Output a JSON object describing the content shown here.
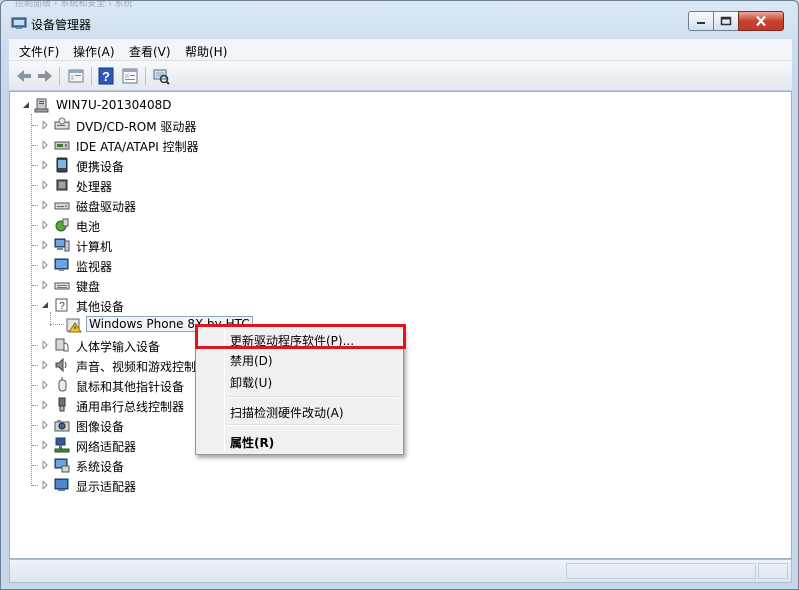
{
  "window": {
    "title": "设备管理器",
    "background_hint": "控制面板 › 系统和安全 › 系统"
  },
  "caption_buttons": {
    "min_icon": "minimize-icon",
    "max_icon": "maximize-icon",
    "close_icon": "close-icon"
  },
  "menu": [
    "文件(F)",
    "操作(A)",
    "查看(V)",
    "帮助(H)"
  ],
  "toolbar": [
    "back-arrow-icon",
    "forward-arrow-icon",
    "properties-icon",
    "help-icon",
    "properties-sheet-icon",
    "scan-hardware-icon"
  ],
  "tree": {
    "root": "WIN7U-20130408D",
    "nodes": [
      {
        "label": "DVD/CD-ROM 驱动器",
        "icon": "dvd-drive-icon"
      },
      {
        "label": "IDE ATA/ATAPI 控制器",
        "icon": "ide-controller-icon"
      },
      {
        "label": "便携设备",
        "icon": "portable-device-icon"
      },
      {
        "label": "处理器",
        "icon": "processor-icon"
      },
      {
        "label": "磁盘驱动器",
        "icon": "disk-drive-icon"
      },
      {
        "label": "电池",
        "icon": "battery-icon"
      },
      {
        "label": "计算机",
        "icon": "computer-icon"
      },
      {
        "label": "监视器",
        "icon": "monitor-icon"
      },
      {
        "label": "键盘",
        "icon": "keyboard-icon"
      },
      {
        "label": "其他设备",
        "icon": "other-devices-icon",
        "expanded": true
      },
      {
        "label": "Windows Phone 8X by HTC",
        "icon": "warning-device-icon",
        "child": true,
        "selected": true
      },
      {
        "label": "人体学输入设备",
        "icon": "hid-icon"
      },
      {
        "label": "声音、视频和游戏控制器",
        "icon": "sound-icon"
      },
      {
        "label": "鼠标和其他指针设备",
        "icon": "mouse-icon"
      },
      {
        "label": "通用串行总线控制器",
        "icon": "usb-icon"
      },
      {
        "label": "图像设备",
        "icon": "imaging-icon"
      },
      {
        "label": "网络适配器",
        "icon": "network-adapter-icon"
      },
      {
        "label": "系统设备",
        "icon": "system-device-icon"
      },
      {
        "label": "显示适配器",
        "icon": "display-adapter-icon"
      }
    ]
  },
  "context_menu": {
    "items": [
      {
        "label": "更新驱动程序软件(P)...",
        "highlighted": true
      },
      {
        "label": "禁用(D)"
      },
      {
        "label": "卸载(U)"
      },
      {
        "separator": true
      },
      {
        "label": "扫描检测硬件改动(A)"
      },
      {
        "separator": true
      },
      {
        "label": "属性(R)",
        "bold": true
      }
    ]
  },
  "colors": {
    "highlight_border": "#e0141e",
    "title_bg": "#d4e2f1",
    "close_button": "#c7432c"
  }
}
